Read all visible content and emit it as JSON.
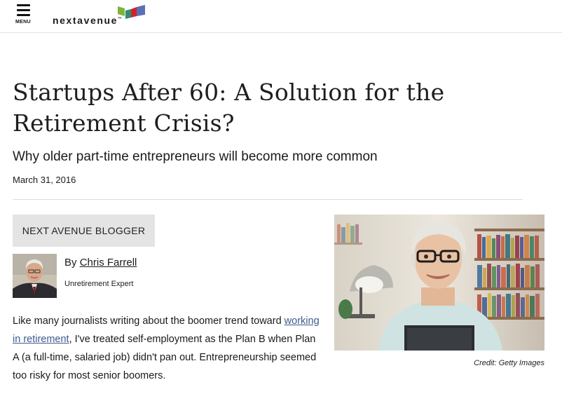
{
  "header": {
    "menu_label": "MENU",
    "logo_text": "nextavenue",
    "logo_trademark": "™"
  },
  "article": {
    "title": "Startups After 60: A Solution for the Retirement Crisis?",
    "subtitle": "Why older part-time entrepreneurs will become more common",
    "date": "March 31, 2016",
    "blogger_tag": "NEXT AVENUE BLOGGER",
    "byline_prefix": "By ",
    "author_name": "Chris Farrell",
    "author_role": "Unretirement Expert",
    "body": {
      "before_link": "Like many journalists writing about the boomer trend toward ",
      "link_text": "working in retirement",
      "after_link": ", I've treated self-employment as the Plan B when Plan A (a full-time, salaried job) didn't pan out. Entrepreneurship seemed too risky for most senior boomers."
    },
    "image_credit": "Credit: Getty Images"
  },
  "colors": {
    "logo_green": "#7fb33a",
    "logo_teal": "#2f8c7c",
    "logo_blue": "#5b6fb5",
    "logo_red": "#d2232a",
    "link_blue": "#3d5a8c"
  },
  "icons": {
    "menu": "hamburger-icon"
  }
}
